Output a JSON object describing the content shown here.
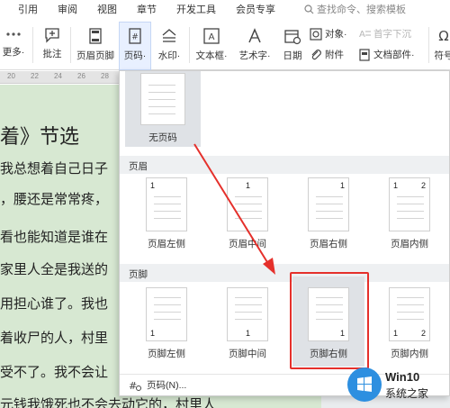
{
  "tabs": [
    "引用",
    "审阅",
    "视图",
    "章节",
    "开发工具",
    "会员专享"
  ],
  "search": {
    "placeholder": "查找命令、搜索模板"
  },
  "ribbon": {
    "more": "更多",
    "comment": "批注",
    "header_footer": "页眉页脚",
    "page_number": "页码",
    "watermark": "水印",
    "textbox": "文本框",
    "wordart": "艺术字",
    "date": "日期",
    "object": "对象",
    "attachment": "附件",
    "drop_cap": "首字下沉",
    "doc_parts": "文档部件",
    "symbol": "符号"
  },
  "ruler": [
    "20",
    "22",
    "24",
    "26",
    "28"
  ],
  "document": {
    "title": "着》节选",
    "lines": [
      "我总想着自己日子",
      "，腰还是常常疼，",
      "看也能知道是谁在",
      "家里人全是我送的",
      "用担心谁了。我也",
      "着收尸的人，村里",
      "受不了。我不会让",
      "元钱我饿死也不会去动它的，村里人"
    ]
  },
  "dropdown": {
    "no_page_number": "无页码",
    "header_section": "页眉",
    "header_options": [
      {
        "label": "页眉左侧",
        "num_left": "1",
        "num_right": ""
      },
      {
        "label": "页眉中间",
        "num_left": "1",
        "num_right": ""
      },
      {
        "label": "页眉右侧",
        "num_left": "1",
        "num_right": ""
      },
      {
        "label": "页眉内侧",
        "num_left": "1",
        "num_right": "2"
      }
    ],
    "footer_section": "页脚",
    "footer_options": [
      {
        "label": "页脚左侧",
        "num_left": "1",
        "num_right": ""
      },
      {
        "label": "页脚中间",
        "num_left": "1",
        "num_right": ""
      },
      {
        "label": "页脚右侧",
        "num_left": "1",
        "num_right": ""
      },
      {
        "label": "页脚内侧",
        "num_left": "1",
        "num_right": "2"
      }
    ],
    "more_page_numbers": "页码(N)..."
  },
  "annotation": {
    "arrow_color": "#e5302b",
    "box_color": "#e5302b"
  },
  "watermark_logo": {
    "title": "Win10",
    "subtitle": "系统之家"
  }
}
